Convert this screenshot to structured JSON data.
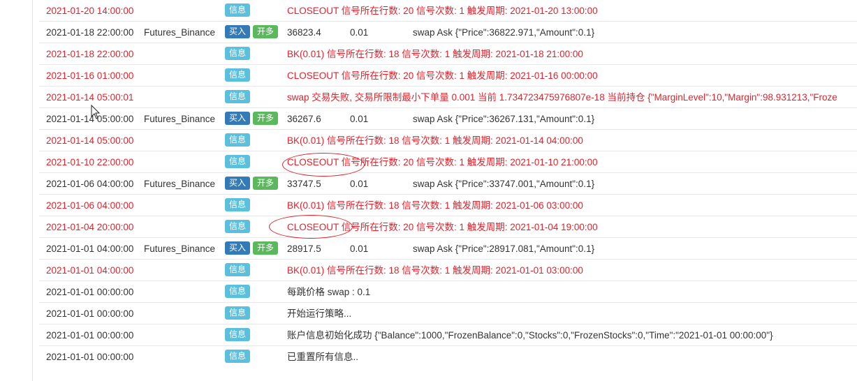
{
  "rows": [
    {
      "type": "info",
      "time": "2021-01-20 14:00:00",
      "badge": "信息",
      "info": "CLOSEOUT 信号所在行数: 20 信号次数: 1 触发周期: 2021-01-20 13:00:00",
      "red": true
    },
    {
      "type": "trade",
      "time": "2021-01-18 22:00:00",
      "exchange": "Futures_Binance",
      "badge1": "买入",
      "badge2": "开多",
      "price": "36823.4",
      "amount": "0.01",
      "ext": "swap Ask {\"Price\":36822.971,\"Amount\":0.1}"
    },
    {
      "type": "info",
      "time": "2021-01-18 22:00:00",
      "badge": "信息",
      "info": "BK(0.01) 信号所在行数: 18 信号次数: 1 触发周期: 2021-01-18 21:00:00",
      "red": true
    },
    {
      "type": "info",
      "time": "2021-01-16 01:00:00",
      "badge": "信息",
      "info": "CLOSEOUT 信号所在行数: 20 信号次数: 1 触发周期: 2021-01-16 00:00:00",
      "red": true
    },
    {
      "type": "info",
      "time": "2021-01-14 05:00:01",
      "badge": "信息",
      "info": "swap 交易失败, 交易所限制最小下单量 0.001 当前 1.734723475976807e-18 当前持仓 {\"MarginLevel\":10,\"Margin\":98.931213,\"Froze",
      "red": true
    },
    {
      "type": "trade",
      "time": "2021-01-14 05:00:00",
      "exchange": "Futures_Binance",
      "badge1": "买入",
      "badge2": "开多",
      "price": "36267.6",
      "amount": "0.01",
      "ext": "swap Ask {\"Price\":36267.131,\"Amount\":0.1}"
    },
    {
      "type": "info",
      "time": "2021-01-14 05:00:00",
      "badge": "信息",
      "info": "BK(0.01) 信号所在行数: 18 信号次数: 1 触发周期: 2021-01-14 04:00:00",
      "red": true
    },
    {
      "type": "info",
      "time": "2021-01-10 22:00:00",
      "badge": "信息",
      "info": "CLOSEOUT 信号所在行数: 20 信号次数: 1 触发周期: 2021-01-10 21:00:00",
      "red": true
    },
    {
      "type": "trade",
      "time": "2021-01-06 04:00:00",
      "exchange": "Futures_Binance",
      "badge1": "买入",
      "badge2": "开多",
      "price": "33747.5",
      "amount": "0.01",
      "ext": "swap Ask {\"Price\":33747.001,\"Amount\":0.1}"
    },
    {
      "type": "info",
      "time": "2021-01-06 04:00:00",
      "badge": "信息",
      "info": "BK(0.01) 信号所在行数: 18 信号次数: 1 触发周期: 2021-01-06 03:00:00",
      "red": true
    },
    {
      "type": "info",
      "time": "2021-01-04 20:00:00",
      "badge": "信息",
      "info": "CLOSEOUT 信号所在行数: 20 信号次数: 1 触发周期: 2021-01-04 19:00:00",
      "red": true
    },
    {
      "type": "trade",
      "time": "2021-01-01 04:00:00",
      "exchange": "Futures_Binance",
      "badge1": "买入",
      "badge2": "开多",
      "price": "28917.5",
      "amount": "0.01",
      "ext": "swap Ask {\"Price\":28917.081,\"Amount\":0.1}"
    },
    {
      "type": "info",
      "time": "2021-01-01 04:00:00",
      "badge": "信息",
      "info": "BK(0.01) 信号所在行数: 18 信号次数: 1 触发周期: 2021-01-01 03:00:00",
      "red": true
    },
    {
      "type": "info",
      "time": "2021-01-01 00:00:00",
      "badge": "信息",
      "info": "每跳价格 swap : 0.1",
      "red": false
    },
    {
      "type": "info",
      "time": "2021-01-01 00:00:00",
      "badge": "信息",
      "info": "开始运行策略...",
      "red": false
    },
    {
      "type": "info",
      "time": "2021-01-01 00:00:00",
      "badge": "信息",
      "info": "账户信息初始化成功 {\"Balance\":1000,\"FrozenBalance\":0,\"Stocks\":0,\"FrozenStocks\":0,\"Time\":\"2021-01-01 00:00:00\"}",
      "red": false
    },
    {
      "type": "info",
      "time": "2021-01-01 00:00:00",
      "badge": "信息",
      "info": "已重置所有信息..",
      "red": false
    }
  ],
  "colors": {
    "info_badge": "#5bc0de",
    "buy_badge": "#337ab7",
    "long_badge": "#5cb85c",
    "signal_text": "#e4212b",
    "annotation": "#d9262b"
  }
}
